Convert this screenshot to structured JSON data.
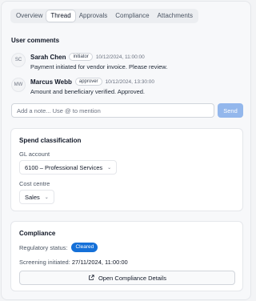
{
  "tabs": [
    {
      "label": "Overview"
    },
    {
      "label": "Thread"
    },
    {
      "label": "Approvals"
    },
    {
      "label": "Compliance"
    },
    {
      "label": "Attachments"
    }
  ],
  "active_tab": "Thread",
  "comments_section": {
    "title": "User comments"
  },
  "comments": [
    {
      "initials": "SC",
      "name": "Sarah Chen",
      "role": "initiator",
      "timestamp": "10/12/2024, 11:00:00",
      "text": "Payment initiated for vendor invoice. Please review."
    },
    {
      "initials": "MW",
      "name": "Marcus Webb",
      "role": "approver",
      "timestamp": "10/12/2024, 13:30:00",
      "text": "Amount and beneficiary verified. Approved."
    }
  ],
  "note": {
    "placeholder": "Add a note... Use @ to mention",
    "value": "",
    "send_label": "Send"
  },
  "spend": {
    "title": "Spend classification",
    "gl_label": "GL account",
    "gl_value": "6100 – Professional Services",
    "cc_label": "Cost centre",
    "cc_value": "Sales"
  },
  "compliance": {
    "title": "Compliance",
    "status_label": "Regulatory status:",
    "status_value": "Cleared",
    "screening_label": "Screening initiated:",
    "screening_value": "27/11/2024, 11:00:00",
    "button_label": "Open Compliance Details"
  },
  "colors": {
    "accent": "#1570d8",
    "send_disabled": "#93b7ec"
  }
}
